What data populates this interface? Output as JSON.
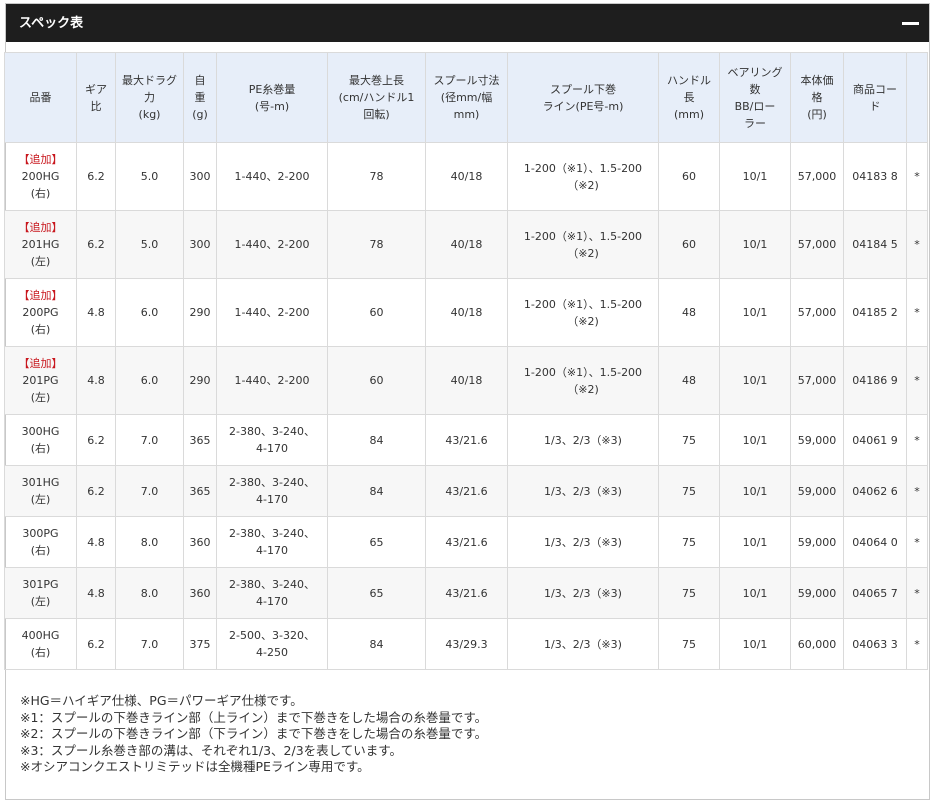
{
  "panel": {
    "title": "スペック表"
  },
  "headers": [
    [
      "品番"
    ],
    [
      "ギア",
      "比"
    ],
    [
      "最大ドラグ",
      "力",
      "(kg)"
    ],
    [
      "自",
      "重",
      "(g)"
    ],
    [
      "PE糸巻量",
      "(号-m)"
    ],
    [
      "最大巻上長",
      "(cm/ハンドル1",
      "回転)"
    ],
    [
      "スプール寸法",
      "(径mm/幅",
      "mm)"
    ],
    [
      "スプール下巻",
      "ライン(PE号-m)"
    ],
    [
      "ハンドル",
      "長",
      "(mm)"
    ],
    [
      "ベアリング",
      "数",
      "BB/ロー",
      "ラー"
    ],
    [
      "本体価",
      "格",
      "(円)"
    ],
    [
      "商品コー",
      "ド"
    ],
    [
      ""
    ]
  ],
  "rows": [
    {
      "tag": "【追加】",
      "model": [
        "200HG",
        "(右)"
      ],
      "gear": "6.2",
      "drag": "5.0",
      "weight": "300",
      "pe": [
        "1-440、2-200"
      ],
      "retrieve": "78",
      "spool": "40/18",
      "under": [
        "1-200（※1）、1.5-200",
        "（※2)"
      ],
      "handle": "60",
      "bearing": "10/1",
      "price": "57,000",
      "code": "04183 8",
      "mark": "*"
    },
    {
      "tag": "【追加】",
      "model": [
        "201HG",
        "(左)"
      ],
      "gear": "6.2",
      "drag": "5.0",
      "weight": "300",
      "pe": [
        "1-440、2-200"
      ],
      "retrieve": "78",
      "spool": "40/18",
      "under": [
        "1-200（※1）、1.5-200",
        "（※2)"
      ],
      "handle": "60",
      "bearing": "10/1",
      "price": "57,000",
      "code": "04184 5",
      "mark": "*"
    },
    {
      "tag": "【追加】",
      "model": [
        "200PG",
        "(右)"
      ],
      "gear": "4.8",
      "drag": "6.0",
      "weight": "290",
      "pe": [
        "1-440、2-200"
      ],
      "retrieve": "60",
      "spool": "40/18",
      "under": [
        "1-200（※1）、1.5-200",
        "（※2)"
      ],
      "handle": "48",
      "bearing": "10/1",
      "price": "57,000",
      "code": "04185 2",
      "mark": "*"
    },
    {
      "tag": "【追加】",
      "model": [
        "201PG",
        "(左)"
      ],
      "gear": "4.8",
      "drag": "6.0",
      "weight": "290",
      "pe": [
        "1-440、2-200"
      ],
      "retrieve": "60",
      "spool": "40/18",
      "under": [
        "1-200（※1）、1.5-200",
        "（※2)"
      ],
      "handle": "48",
      "bearing": "10/1",
      "price": "57,000",
      "code": "04186 9",
      "mark": "*"
    },
    {
      "tag": "",
      "model": [
        "300HG",
        "(右)"
      ],
      "gear": "6.2",
      "drag": "7.0",
      "weight": "365",
      "pe": [
        "2-380、3-240、",
        "4-170"
      ],
      "retrieve": "84",
      "spool": "43/21.6",
      "under": [
        "1/3、2/3（※3)"
      ],
      "handle": "75",
      "bearing": "10/1",
      "price": "59,000",
      "code": "04061 9",
      "mark": "*"
    },
    {
      "tag": "",
      "model": [
        "301HG",
        "(左)"
      ],
      "gear": "6.2",
      "drag": "7.0",
      "weight": "365",
      "pe": [
        "2-380、3-240、",
        "4-170"
      ],
      "retrieve": "84",
      "spool": "43/21.6",
      "under": [
        "1/3、2/3（※3)"
      ],
      "handle": "75",
      "bearing": "10/1",
      "price": "59,000",
      "code": "04062 6",
      "mark": "*"
    },
    {
      "tag": "",
      "model": [
        "300PG",
        "(右)"
      ],
      "gear": "4.8",
      "drag": "8.0",
      "weight": "360",
      "pe": [
        "2-380、3-240、",
        "4-170"
      ],
      "retrieve": "65",
      "spool": "43/21.6",
      "under": [
        "1/3、2/3（※3)"
      ],
      "handle": "75",
      "bearing": "10/1",
      "price": "59,000",
      "code": "04064 0",
      "mark": "*"
    },
    {
      "tag": "",
      "model": [
        "301PG",
        "(左)"
      ],
      "gear": "4.8",
      "drag": "8.0",
      "weight": "360",
      "pe": [
        "2-380、3-240、",
        "4-170"
      ],
      "retrieve": "65",
      "spool": "43/21.6",
      "under": [
        "1/3、2/3（※3)"
      ],
      "handle": "75",
      "bearing": "10/1",
      "price": "59,000",
      "code": "04065 7",
      "mark": "*"
    },
    {
      "tag": "",
      "model": [
        "400HG",
        "(右)"
      ],
      "gear": "6.2",
      "drag": "7.0",
      "weight": "375",
      "pe": [
        "2-500、3-320、",
        "4-250"
      ],
      "retrieve": "84",
      "spool": "43/29.3",
      "under": [
        "1/3、2/3（※3)"
      ],
      "handle": "75",
      "bearing": "10/1",
      "price": "60,000",
      "code": "04063 3",
      "mark": "*"
    }
  ],
  "notes": [
    "※HG＝ハイギア仕様、PG＝パワーギア仕様です。",
    "※1：スプールの下巻きライン部（上ライン）まで下巻きをした場合の糸巻量です。",
    "※2：スプールの下巻きライン部（下ライン）まで下巻きをした場合の糸巻量です。",
    "※3：スプール糸巻き部の溝は、それぞれ1/3、2/3を表しています。",
    "※オシアコンクエストリミテッドは全機種PEライン専用です。"
  ],
  "colors": {
    "header_bar": "#1e1e1e",
    "table_header_bg": "#e7eef9",
    "tag_red": "#c8161d",
    "even_row_bg": "#f7f7f7"
  }
}
